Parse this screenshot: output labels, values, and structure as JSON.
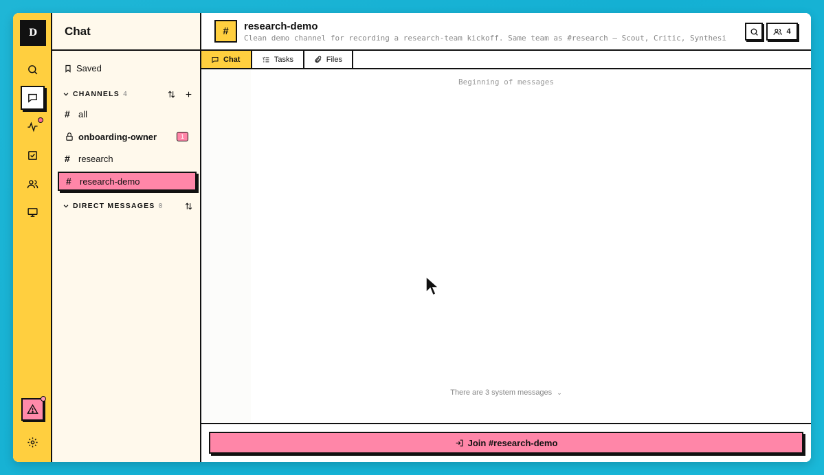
{
  "rail": {
    "logo": "D",
    "items": [
      {
        "icon": "search-icon"
      },
      {
        "icon": "chat-icon",
        "active": true
      },
      {
        "icon": "activity-icon",
        "notify": true
      },
      {
        "icon": "tasks-icon"
      },
      {
        "icon": "people-icon"
      },
      {
        "icon": "monitor-icon"
      }
    ],
    "bottom": [
      {
        "icon": "alert-icon",
        "notify": true
      },
      {
        "icon": "gear-icon"
      }
    ]
  },
  "sidebar": {
    "title": "Chat",
    "saved_label": "Saved",
    "channels": {
      "label": "CHANNELS",
      "count": "4",
      "items": [
        {
          "name": "all",
          "type": "public"
        },
        {
          "name": "onboarding-owner",
          "type": "private",
          "badge": "1",
          "bold": true
        },
        {
          "name": "research",
          "type": "public"
        },
        {
          "name": "research-demo",
          "type": "public",
          "active": true
        }
      ]
    },
    "dms": {
      "label": "DIRECT MESSAGES",
      "count": "0"
    }
  },
  "header": {
    "icon": "#",
    "title": "research-demo",
    "description": "Clean demo channel for recording a research-team kickoff. Same team as #research — Scout, Critic, Synthesi",
    "members_count": "4"
  },
  "tabs": [
    {
      "label": "Chat",
      "active": true
    },
    {
      "label": "Tasks"
    },
    {
      "label": "Files"
    }
  ],
  "messages": {
    "beginning": "Beginning of messages",
    "system_note": "There are 3 system messages"
  },
  "footer": {
    "join_label": "Join #research-demo"
  },
  "colors": {
    "accent_yellow": "#ffcf3f",
    "accent_pink": "#ff86a8",
    "sidebar_bg": "#fff9ec"
  }
}
